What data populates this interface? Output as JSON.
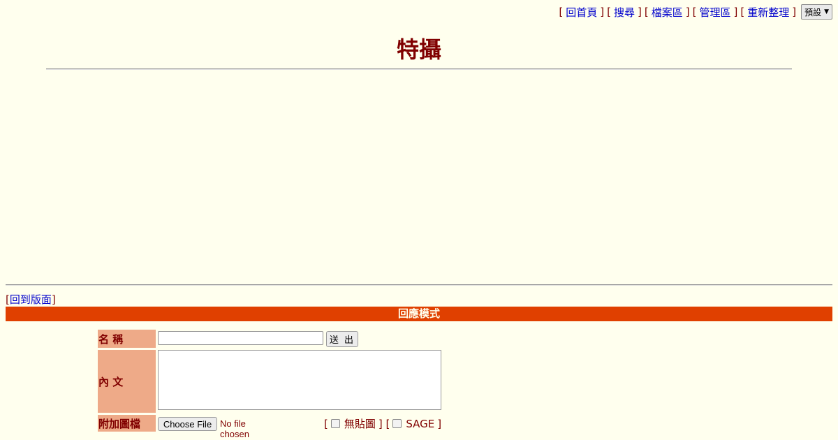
{
  "topnav": {
    "links": [
      "回首頁",
      "搜尋",
      "檔案區",
      "管理區",
      "重新整理"
    ],
    "style_select": "預設"
  },
  "board_title": "特攝",
  "back_link": "回到版面",
  "mode_bar": "回應模式",
  "form": {
    "name_label": "名 稱",
    "body_label": "內 文",
    "file_label": "附加圖檔",
    "name_value": "",
    "body_value": "",
    "submit_label": "送 出",
    "file_button": "Choose File",
    "file_status": "No file chosen",
    "noimage_label": "無貼圖",
    "sage_label": "SAGE"
  }
}
